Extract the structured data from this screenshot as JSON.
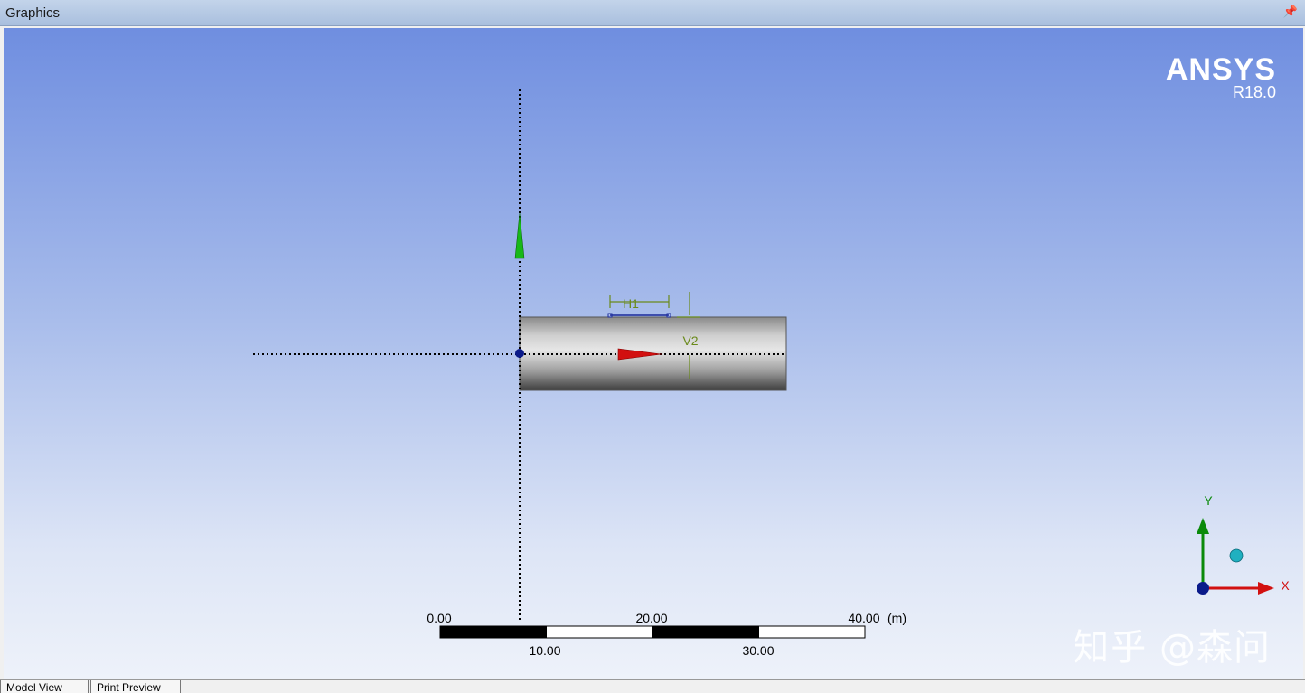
{
  "window": {
    "title": "Graphics",
    "pin_glyph": "↑"
  },
  "brand": {
    "name": "ANSYS",
    "version": "R18.0"
  },
  "dimensions": {
    "h1": "H1",
    "v2": "V2"
  },
  "scale_bar": {
    "unit": "(m)",
    "top_labels": [
      "0.00",
      "20.00",
      "40.00"
    ],
    "bottom_labels": [
      "10.00",
      "30.00"
    ]
  },
  "triad": {
    "x_label": "X",
    "y_label": "Y"
  },
  "tabs": [
    {
      "label": "Model View"
    },
    {
      "label": "Print Preview"
    }
  ],
  "watermark": "知乎 @森问",
  "colors": {
    "x_axis": "#d21010",
    "y_axis": "#0a8a0a",
    "dimension": "#6a8a1a",
    "point": "#0a1a8a"
  }
}
